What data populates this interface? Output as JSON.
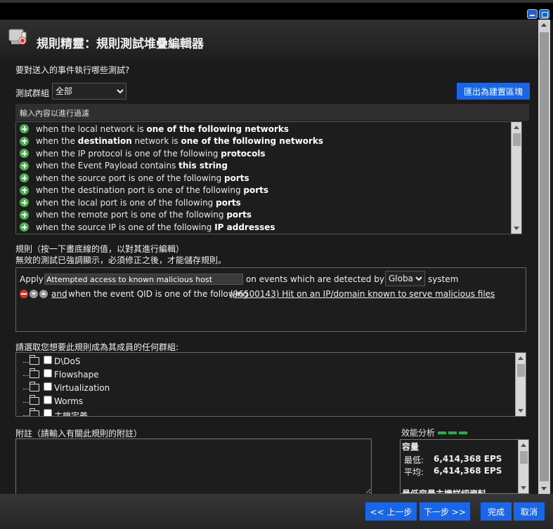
{
  "window": {
    "minimize_icon": "minimize-icon",
    "maximize_icon": "maximize-icon"
  },
  "header": {
    "title": "規則精靈：規則測試堆疊編輯器",
    "icon": "rule-wizard-icon"
  },
  "question": "要對送入的事件執行哪些測試?",
  "test_group": {
    "label": "測試群組",
    "selected": "全部"
  },
  "export_button": "匯出為建置區塊",
  "filter": {
    "placeholder": "輸入內容以進行過濾"
  },
  "tests": [
    {
      "pre": "when the local network is ",
      "bold": "one of the following networks",
      "post": ""
    },
    {
      "pre": "when the ",
      "bold": "destination",
      "post": " network is ",
      "bold2": "one of the following networks"
    },
    {
      "pre": "when the IP protocol is one of the following ",
      "bold": "protocols",
      "post": ""
    },
    {
      "pre": "when the Event Payload contains ",
      "bold": "this string",
      "post": ""
    },
    {
      "pre": "when the source port is one of the following ",
      "bold": "ports",
      "post": ""
    },
    {
      "pre": "when the destination port is one of the following ",
      "bold": "ports",
      "post": ""
    },
    {
      "pre": "when the local port is one of the following ",
      "bold": "ports",
      "post": ""
    },
    {
      "pre": "when the remote port is one of the following ",
      "bold": "ports",
      "post": ""
    },
    {
      "pre": "when the source IP is one of the following ",
      "bold": "IP addresses",
      "post": ""
    }
  ],
  "rule_section": {
    "label1": "規則（按一下畫底線的值，以對其進行編輯）",
    "label2": "無效的測試已強調顯示，必須修正之後，才能儲存規則。",
    "apply": "Apply",
    "rule_name": "Attempted access to known malicious host",
    "on_events": "on events which are detected by the",
    "scope": "Global",
    "system": "system",
    "and": "and",
    "condition": "when the event QID is one of the following",
    "qid_link": "(96500143) Hit on an IP/domain known to serve malicious files"
  },
  "groups_label": "請選取您想要此規則成為其成員的任何群組:",
  "groups": [
    "D\\DoS",
    "Flowshape",
    "Virtualization",
    "Worms",
    "主機定義"
  ],
  "notes_label": "附註（請輸入有關此規則的附註）",
  "perf": {
    "label": "效能分析",
    "capacity": "容量",
    "min_label": "最低:",
    "min_value": "6,414,368 EPS",
    "avg_label": "平均:",
    "avg_value": "6,414,368 EPS",
    "more": "最低容量主機詳細資料",
    "bar_color": "#22b24c"
  },
  "footer": {
    "back": "<< 上一步",
    "next": "下一步 >>",
    "finish": "完成",
    "cancel": "取消"
  },
  "colors": {
    "accent": "#1a66e6",
    "link": "#4caf50",
    "delete": "#d9342b"
  }
}
